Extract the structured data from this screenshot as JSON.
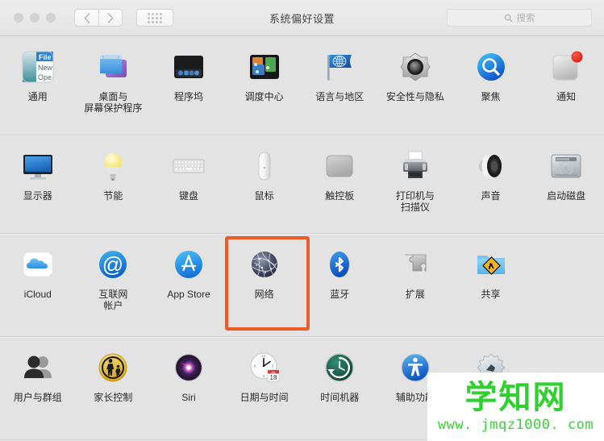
{
  "window": {
    "title": "系统偏好设置",
    "traffic_lights": [
      "close",
      "minimize",
      "zoom"
    ],
    "nav_back_icon": "chevron-left-icon",
    "nav_forward_icon": "chevron-right-icon",
    "show_all_icon": "grid-dots-icon",
    "accent_highlight_color": "#f05a28"
  },
  "search": {
    "placeholder": "搜索",
    "value": "",
    "icon": "search-icon"
  },
  "rows": [
    {
      "items": [
        {
          "label": "通用",
          "icon": "general-icon"
        },
        {
          "label": "桌面与\n屏幕保护程序",
          "icon": "desktop-screensaver-icon"
        },
        {
          "label": "程序坞",
          "icon": "dock-icon"
        },
        {
          "label": "调度中心",
          "icon": "mission-control-icon"
        },
        {
          "label": "语言与地区",
          "icon": "language-region-icon"
        },
        {
          "label": "安全性与隐私",
          "icon": "security-privacy-icon"
        },
        {
          "label": "聚焦",
          "icon": "spotlight-icon"
        },
        {
          "label": "通知",
          "icon": "notifications-icon"
        }
      ]
    },
    {
      "items": [
        {
          "label": "显示器",
          "icon": "displays-icon"
        },
        {
          "label": "节能",
          "icon": "energy-saver-icon"
        },
        {
          "label": "键盘",
          "icon": "keyboard-icon"
        },
        {
          "label": "鼠标",
          "icon": "mouse-icon"
        },
        {
          "label": "触控板",
          "icon": "trackpad-icon"
        },
        {
          "label": "打印机与\n扫描仪",
          "icon": "printers-scanners-icon"
        },
        {
          "label": "声音",
          "icon": "sound-icon"
        },
        {
          "label": "启动磁盘",
          "icon": "startup-disk-icon"
        }
      ]
    },
    {
      "items": [
        {
          "label": "iCloud",
          "icon": "icloud-icon"
        },
        {
          "label": "互联网\n帐户",
          "icon": "internet-accounts-icon"
        },
        {
          "label": "App Store",
          "icon": "app-store-icon"
        },
        {
          "label": "网络",
          "icon": "network-icon",
          "highlighted": true
        },
        {
          "label": "蓝牙",
          "icon": "bluetooth-icon"
        },
        {
          "label": "扩展",
          "icon": "extensions-icon"
        },
        {
          "label": "共享",
          "icon": "sharing-icon"
        }
      ]
    },
    {
      "items": [
        {
          "label": "用户与群组",
          "icon": "users-groups-icon"
        },
        {
          "label": "家长控制",
          "icon": "parental-controls-icon"
        },
        {
          "label": "Siri",
          "icon": "siri-icon"
        },
        {
          "label": "日期与时间",
          "icon": "date-time-icon"
        },
        {
          "label": "时间机器",
          "icon": "time-machine-icon"
        },
        {
          "label": "辅助功能",
          "icon": "accessibility-icon"
        },
        {
          "label": "",
          "icon": "profiles-icon"
        }
      ]
    }
  ],
  "watermark": {
    "brand": "学知网",
    "url": "www. jmqz1000. com",
    "color": "#2fd02f"
  }
}
